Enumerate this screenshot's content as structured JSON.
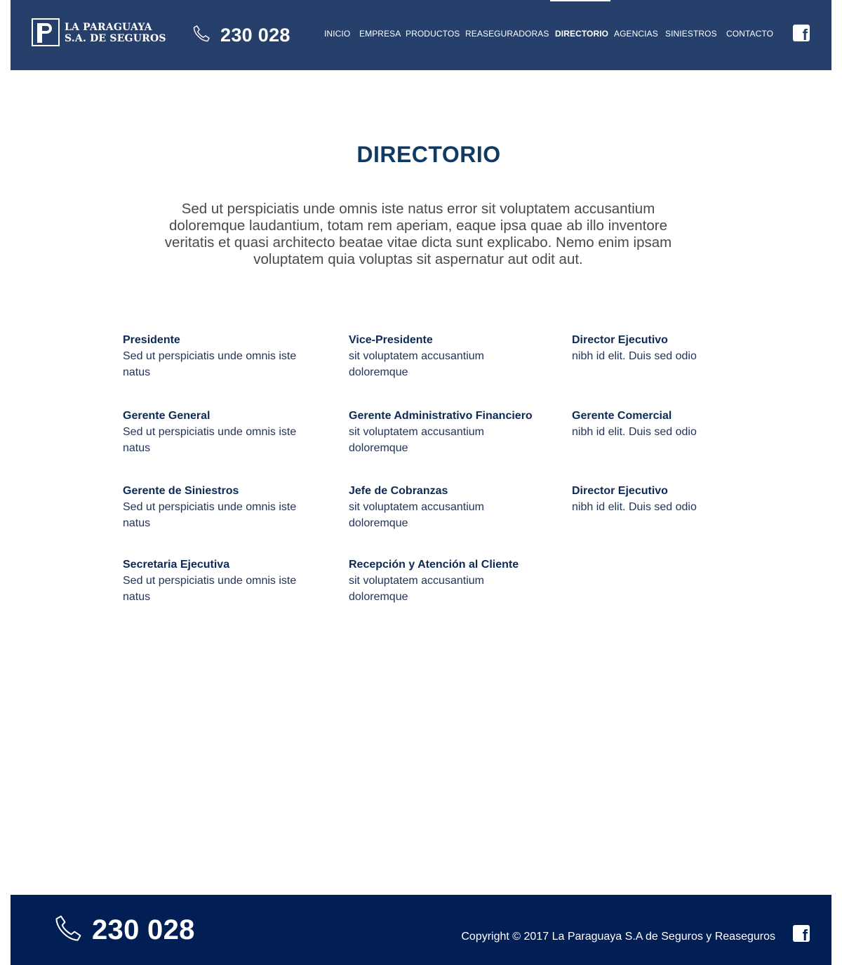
{
  "header": {
    "logo_line1": "LA PARAGUAYA",
    "logo_line2": "S.A. DE SEGUROS",
    "phone": "230 028",
    "nav": [
      "INICIO",
      "EMPRESA",
      "PRODUCTOS",
      "REASEGURADORAS",
      "DIRECTORIO",
      "AGENCIAS",
      "SINIESTROS",
      "CONTACTO"
    ],
    "active_nav": "DIRECTORIO",
    "social_icon": "facebook-icon"
  },
  "main": {
    "title": "DIRECTORIO",
    "intro": "Sed ut perspiciatis unde omnis iste natus error sit voluptatem accusantium doloremque laudantium, totam rem aperiam, eaque ipsa quae ab illo inventore veritatis et quasi architecto beatae vitae dicta sunt explicabo. Nemo enim ipsam voluptatem quia voluptas sit aspernatur aut odit aut.",
    "entries": [
      {
        "title": "Presidente",
        "desc": "Sed ut perspiciatis unde omnis iste natus"
      },
      {
        "title": "Vice-Presidente",
        "desc": "sit voluptatem accusantium doloremque"
      },
      {
        "title": "Director Ejecutivo",
        "desc": "nibh  id elit. Duis sed odio"
      },
      {
        "title": "Gerente General",
        "desc": "Sed ut perspiciatis unde omnis iste natus"
      },
      {
        "title": "Gerente Administrativo Financiero",
        "desc": "sit voluptatem accusantium doloremque"
      },
      {
        "title": "Gerente Comercial",
        "desc": "nibh  id elit. Duis sed odio"
      },
      {
        "title": "Gerente de Siniestros",
        "desc": "Sed ut perspiciatis unde omnis iste natus"
      },
      {
        "title": "Jefe de Cobranzas",
        "desc": "sit voluptatem accusantium doloremque"
      },
      {
        "title": "Director Ejecutivo",
        "desc": "nibh  id elit. Duis sed odio"
      },
      {
        "title": "Secretaria Ejecutiva",
        "desc": "Sed ut perspiciatis unde omnis iste natus"
      },
      {
        "title": "Recepción y Atención al Cliente",
        "desc": "sit voluptatem accusantium doloremque"
      }
    ]
  },
  "footer": {
    "phone": "230 028",
    "copyright": "Copyright © 2017 La Paraguaya S.A de Seguros y Reaseguros",
    "social_icon": "facebook-icon"
  },
  "colors": {
    "header_bg": "#26406b",
    "footer_bg": "#021f55",
    "title": "#0e3a64"
  }
}
